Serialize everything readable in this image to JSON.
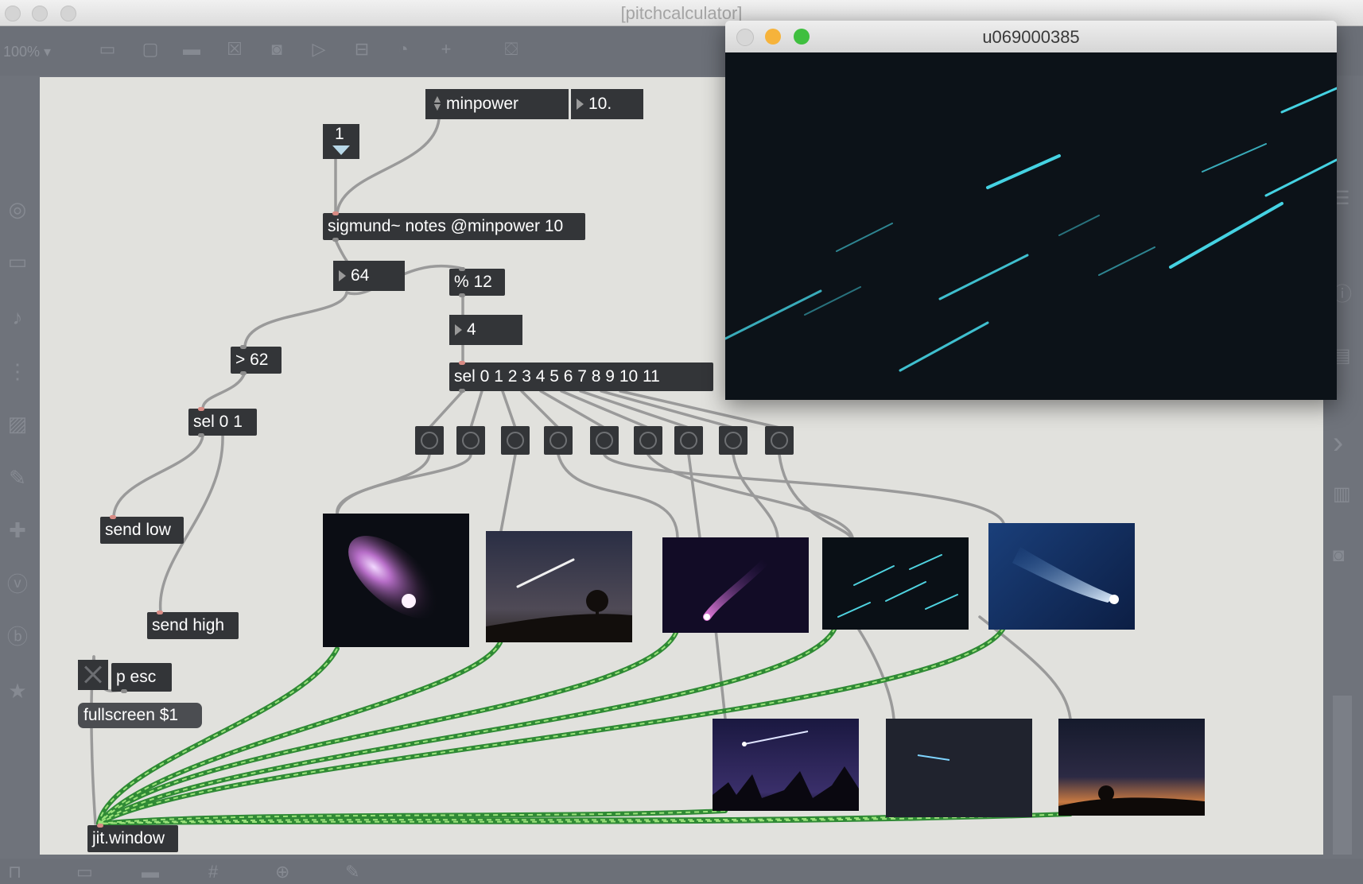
{
  "window": {
    "title": "[pitchcalculator]"
  },
  "toolbar": {
    "zoom": "100% ▾"
  },
  "patch": {
    "minpower_label": "minpower",
    "minpower_value": "10.",
    "int_message": "1",
    "sigmund": "sigmund~ notes @minpower 10",
    "pitch_value": "64",
    "mod_object": "% 12",
    "pitchclass_value": "4",
    "gt_object": "> 62",
    "sel_pitch": "sel 0 1 2 3 4 5 6 7 8 9 10 11",
    "sel_range": "sel 0 1",
    "send_low": "send low",
    "send_high": "send high",
    "p_esc": "p esc",
    "fullscreen": "fullscreen $1",
    "jit_window": "jit.window"
  },
  "subwindow": {
    "title": "u069000385"
  },
  "colors": {
    "canvas": "#e1e1dd",
    "object": "#333538",
    "patch_cord": "#9a9a9a",
    "matrix_cord": "#3fae49",
    "close_button": "#d7d7d7",
    "minimize_button": "#f6b33b",
    "zoom_button": "#3fbf3f"
  },
  "icons": {
    "toolbar": [
      "new-object-icon",
      "message-icon",
      "comment-icon",
      "toggle-icon",
      "bang-icon",
      "button-icon",
      "slider-icon",
      "dial-icon",
      "plus-icon",
      "paint-bucket-icon"
    ],
    "left_sidebar": [
      "audio-icon",
      "camera-icon",
      "music-note-icon",
      "sequence-icon",
      "image-icon",
      "paperclip-icon",
      "puzzle-icon",
      "vizzie-icon",
      "beap-icon",
      "star-icon"
    ],
    "right_sidebar": [
      "inspector-icon",
      "info-icon",
      "clue-icon",
      "chevron-right-icon",
      "book-icon",
      "snapshot-icon",
      "level-meter-icon"
    ],
    "bottom_bar": [
      "lock-icon",
      "presentation-icon",
      "layout-icon",
      "grid-icon",
      "new-object-plus-icon",
      "wrench-icon"
    ]
  }
}
